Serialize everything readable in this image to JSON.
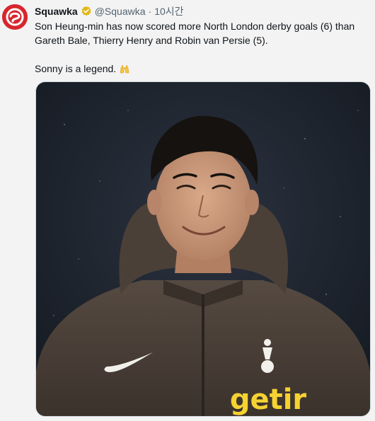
{
  "tweet": {
    "author": {
      "display_name": "Squawka",
      "handle": "@Squawka",
      "verified": true,
      "avatar_icon": "squawka-logo-icon",
      "avatar_color": "#d7262e"
    },
    "separator": "·",
    "timestamp": "10시간",
    "text_line_1": "Son Heung-min has now scored more North London derby goals (6) than Gareth Bale, Thierry Henry and Robin van Persie (5).",
    "text_line_2": "Sonny is a legend.",
    "emoji_icon": "raising-hands-emoji-icon",
    "media": {
      "type": "photo",
      "sponsor_text": "getir",
      "sponsor_color": "#f5d231",
      "jacket_color": "#4a3f37",
      "background_color": "#1e2530"
    }
  },
  "colors": {
    "text_primary": "#0f1419",
    "text_secondary": "#536471",
    "verified_gold": "#e2b719",
    "background": "#f3f3f3"
  }
}
